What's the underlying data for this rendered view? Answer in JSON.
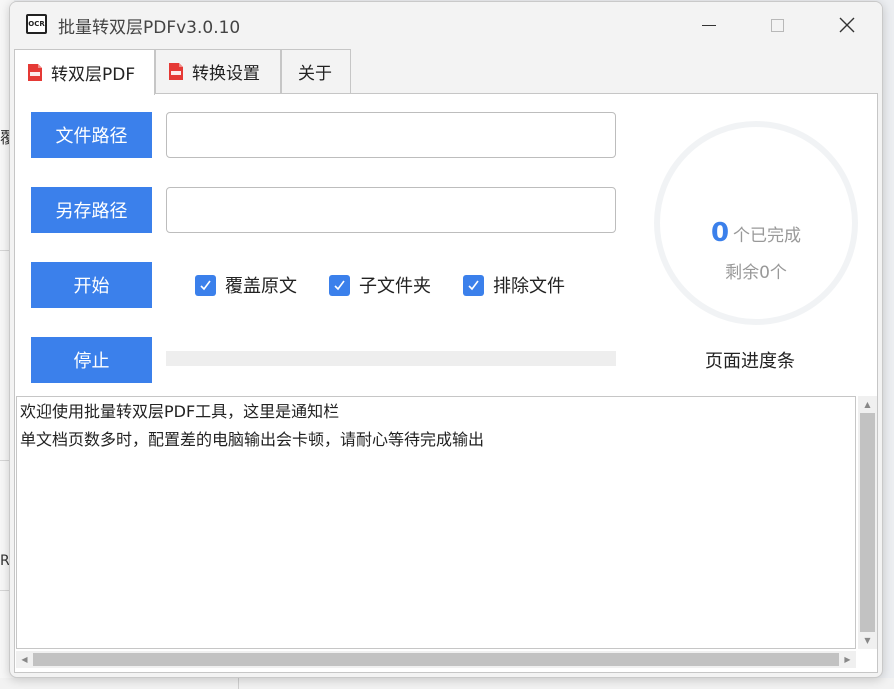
{
  "window": {
    "title": "批量转双层PDFv3.0.10",
    "app_icon_text": "OCR"
  },
  "tabs": [
    {
      "label": "转双层PDF",
      "active": true,
      "icon": "pdf-icon"
    },
    {
      "label": "转换设置",
      "active": false,
      "icon": "pdf-icon"
    },
    {
      "label": "关于",
      "active": false
    }
  ],
  "form": {
    "file_path_button": "文件路径",
    "file_path_value": "",
    "save_path_button": "另存路径",
    "save_path_value": "",
    "start_button": "开始",
    "stop_button": "停止"
  },
  "options": [
    {
      "label": "覆盖原文",
      "checked": true
    },
    {
      "label": "子文件夹",
      "checked": true
    },
    {
      "label": "排除文件",
      "checked": true
    }
  ],
  "status": {
    "completed_count": "0",
    "completed_label": "个已完成",
    "remaining_text": "剩余0个",
    "page_progress_label": "页面进度条",
    "page_progress_value": 0
  },
  "log": {
    "lines": [
      "欢迎使用批量转双层PDF工具，这里是通知栏",
      "单文档页数多时，配置差的电脑输出会卡顿，请耐心等待完成输出"
    ]
  },
  "background_fragments": [
    "覆",
    "RL"
  ],
  "colors": {
    "accent": "#3b80eb",
    "pdf_icon": "#e53935",
    "ring_track": "#f1f3f5"
  }
}
